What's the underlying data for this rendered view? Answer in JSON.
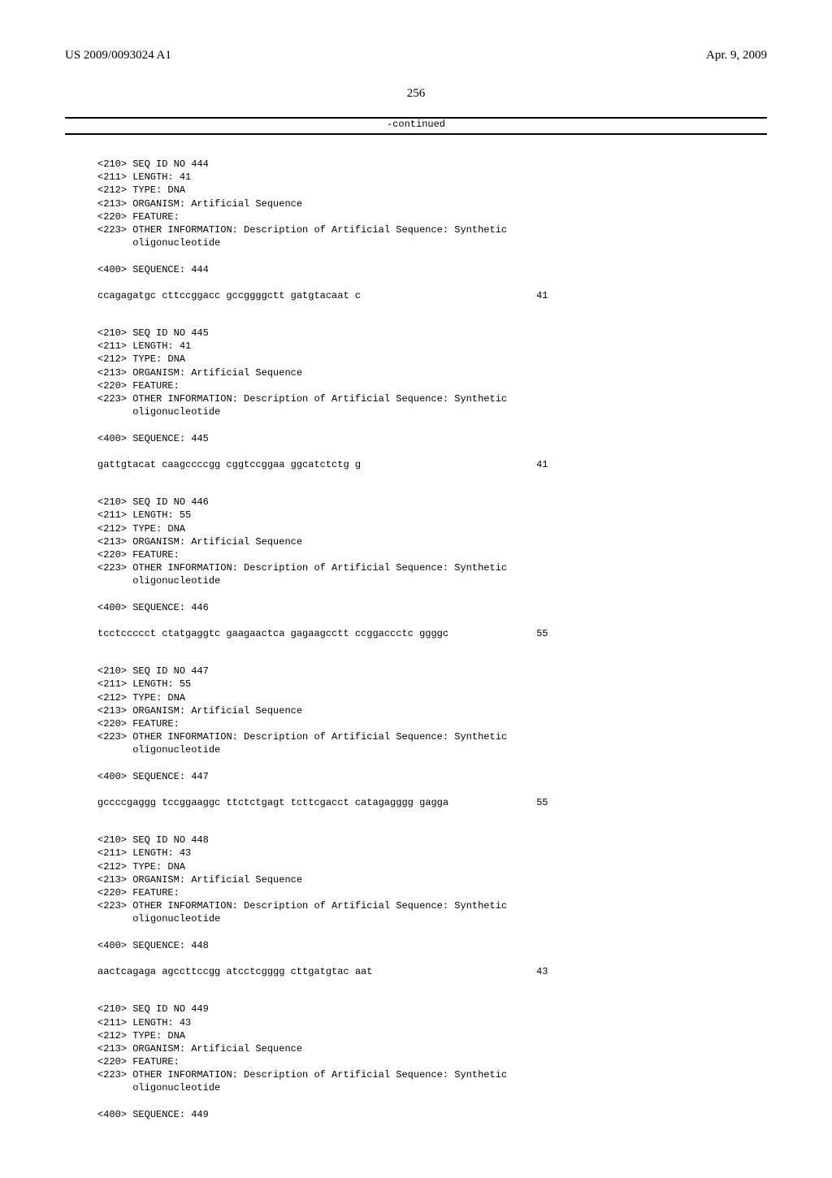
{
  "header": {
    "left": "US 2009/0093024 A1",
    "right": "Apr. 9, 2009"
  },
  "page_number": "256",
  "continued_label": "-continued",
  "sequences": [
    {
      "id": "444",
      "length": "41",
      "type": "DNA",
      "organism": "Artificial Sequence",
      "feature": "FEATURE:",
      "other_info": "OTHER INFORMATION: Description of Artificial Sequence: Synthetic",
      "other_info_cont": "oligonucleotide",
      "seq_label": "SEQUENCE: 444",
      "sequence": "ccagagatgc cttccggacc gccggggctt gatgtacaat c",
      "count": "41"
    },
    {
      "id": "445",
      "length": "41",
      "type": "DNA",
      "organism": "Artificial Sequence",
      "feature": "FEATURE:",
      "other_info": "OTHER INFORMATION: Description of Artificial Sequence: Synthetic",
      "other_info_cont": "oligonucleotide",
      "seq_label": "SEQUENCE: 445",
      "sequence": "gattgtacat caagccccgg cggtccggaa ggcatctctg g",
      "count": "41"
    },
    {
      "id": "446",
      "length": "55",
      "type": "DNA",
      "organism": "Artificial Sequence",
      "feature": "FEATURE:",
      "other_info": "OTHER INFORMATION: Description of Artificial Sequence: Synthetic",
      "other_info_cont": "oligonucleotide",
      "seq_label": "SEQUENCE: 446",
      "sequence": "tcctccccct ctatgaggtc gaagaactca gagaagcctt ccggaccctc ggggc",
      "count": "55"
    },
    {
      "id": "447",
      "length": "55",
      "type": "DNA",
      "organism": "Artificial Sequence",
      "feature": "FEATURE:",
      "other_info": "OTHER INFORMATION: Description of Artificial Sequence: Synthetic",
      "other_info_cont": "oligonucleotide",
      "seq_label": "SEQUENCE: 447",
      "sequence": "gccccgaggg tccggaaggc ttctctgagt tcttcgacct catagagggg gagga",
      "count": "55"
    },
    {
      "id": "448",
      "length": "43",
      "type": "DNA",
      "organism": "Artificial Sequence",
      "feature": "FEATURE:",
      "other_info": "OTHER INFORMATION: Description of Artificial Sequence: Synthetic",
      "other_info_cont": "oligonucleotide",
      "seq_label": "SEQUENCE: 448",
      "sequence": "aactcagaga agccttccgg atcctcgggg cttgatgtac aat",
      "count": "43"
    },
    {
      "id": "449",
      "length": "43",
      "type": "DNA",
      "organism": "Artificial Sequence",
      "feature": "FEATURE:",
      "other_info": "OTHER INFORMATION: Description of Artificial Sequence: Synthetic",
      "other_info_cont": "oligonucleotide",
      "seq_label": "SEQUENCE: 449",
      "sequence": "",
      "count": ""
    }
  ],
  "tags": {
    "t210": "<210> SEQ ID NO ",
    "t211": "<211> LENGTH: ",
    "t212": "<212> TYPE: ",
    "t213": "<213> ORGANISM: ",
    "t220": "<220> ",
    "t223": "<223> ",
    "indent": "      ",
    "t400": "<400> "
  }
}
